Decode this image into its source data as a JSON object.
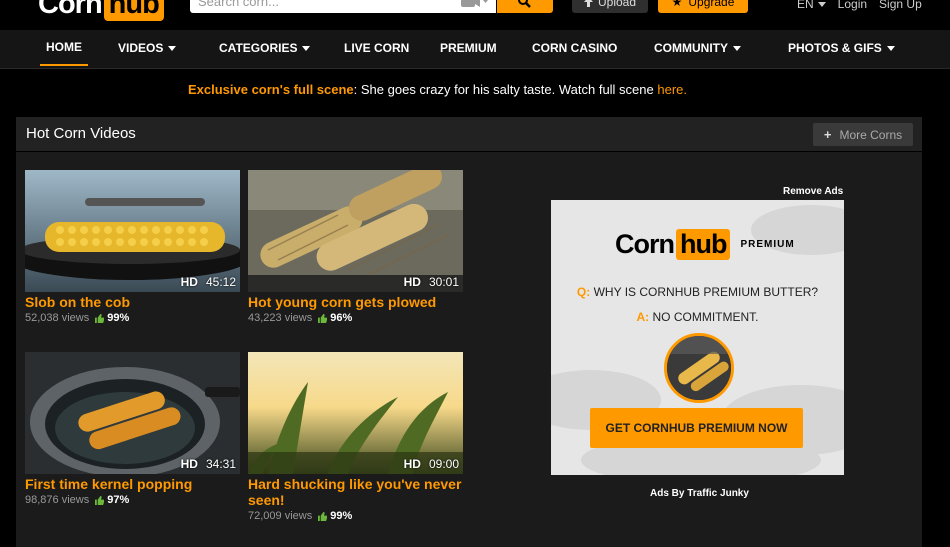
{
  "header": {
    "logo_left": "Corn",
    "logo_right": "hub",
    "search_placeholder": "Search corn...",
    "upload_label": "Upload",
    "upgrade_label": "Upgrade",
    "language": "EN",
    "login": "Login",
    "signup": "Sign Up"
  },
  "nav": {
    "items": [
      {
        "label": "HOME"
      },
      {
        "label": "VIDEOS"
      },
      {
        "label": "CATEGORIES"
      },
      {
        "label": "LIVE CORN"
      },
      {
        "label": "PREMIUM"
      },
      {
        "label": "CORN CASINO"
      },
      {
        "label": "COMMUNITY"
      },
      {
        "label": "PHOTOS & GIFS"
      }
    ]
  },
  "promo": {
    "highlight": "Exclusive corn's full scene",
    "text": ": She goes crazy for his salty taste. Watch full scene ",
    "link": "here."
  },
  "section": {
    "title": "Hot Corn Videos",
    "more_label": "More Corns"
  },
  "videos": [
    {
      "title": "Slob on the cob",
      "hd": "HD",
      "duration": "45:12",
      "views": "52,038 views",
      "rating": "99%"
    },
    {
      "title": "Hot young corn gets plowed",
      "hd": "HD",
      "duration": "30:01",
      "views": "43,223 views",
      "rating": "96%"
    },
    {
      "title": "First time kernel popping",
      "hd": "HD",
      "duration": "34:31",
      "views": "98,876 views",
      "rating": "97%"
    },
    {
      "title": "Hard shucking like you've never seen!",
      "hd": "HD",
      "duration": "09:00",
      "views": "72,009 views",
      "rating": "99%"
    }
  ],
  "ad": {
    "remove_label": "Remove Ads",
    "logo_left": "Corn",
    "logo_right": "hub",
    "logo_suffix": "PREMIUM",
    "q_key": "Q:",
    "q_text": " WHY IS CORNHUB PREMIUM BUTTER?",
    "a_key": "A:",
    "a_text": " NO COMMITMENT.",
    "cta": "GET CORNHUB PREMIUM NOW",
    "ads_by": "Ads By Traffic Junky"
  },
  "colors": {
    "accent": "#ff9900",
    "background": "#000000",
    "panel": "#1b1b1b",
    "rating_icon": "#6cb83a"
  }
}
